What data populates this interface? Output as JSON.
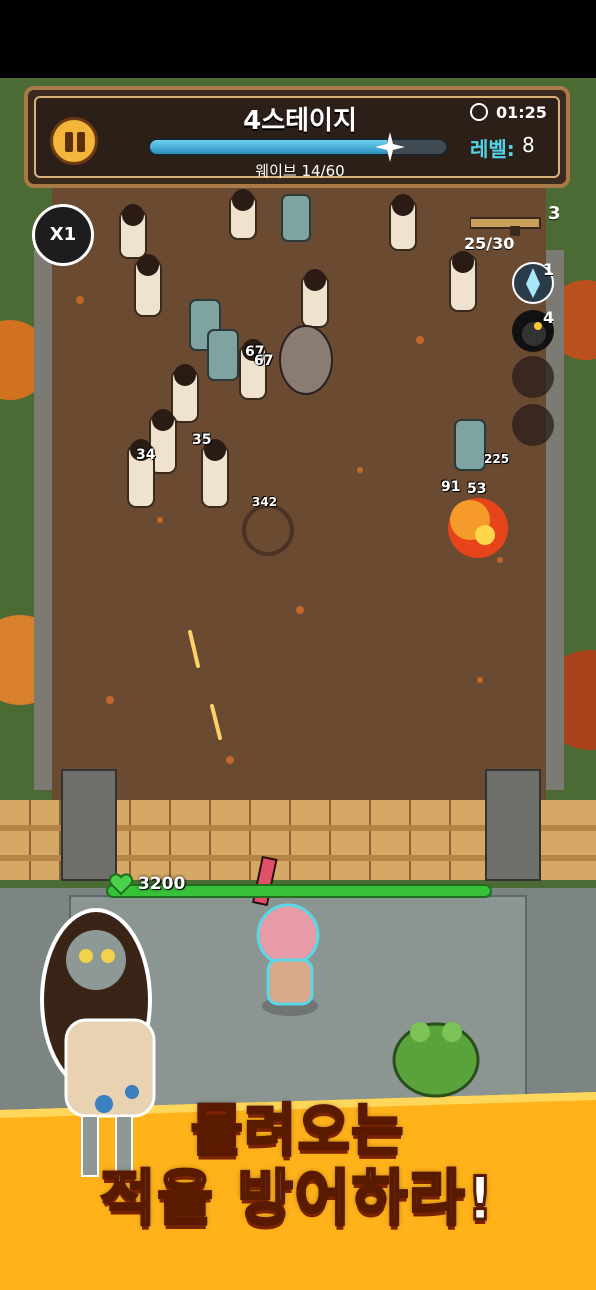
{
  "hud": {
    "stage_title": "4스테이지",
    "timer": "01:25",
    "wave_text": "웨이브 14/60",
    "wave_progress": 0.8,
    "level_label": "레벨:",
    "level_value": "8",
    "speed_label": "X1"
  },
  "weapon": {
    "count": "3",
    "ammo": "25/30"
  },
  "skills": [
    {
      "icon": "crystal-icon",
      "count": "1"
    },
    {
      "icon": "bomb-icon",
      "count": "4"
    }
  ],
  "damage_numbers": [
    "67",
    "67",
    "35",
    "34",
    "342",
    "225",
    "91",
    "53"
  ],
  "player": {
    "hp": "3200"
  },
  "promo": {
    "line1": "몰려오는",
    "line2": "적을 방어하라!"
  },
  "colors": {
    "dirt": "#6b4a32",
    "grass": "#4c6b34",
    "hp_green": "#38c23a",
    "accent_cyan": "#53d3e8",
    "promo_yellow": "#ffb21a"
  }
}
